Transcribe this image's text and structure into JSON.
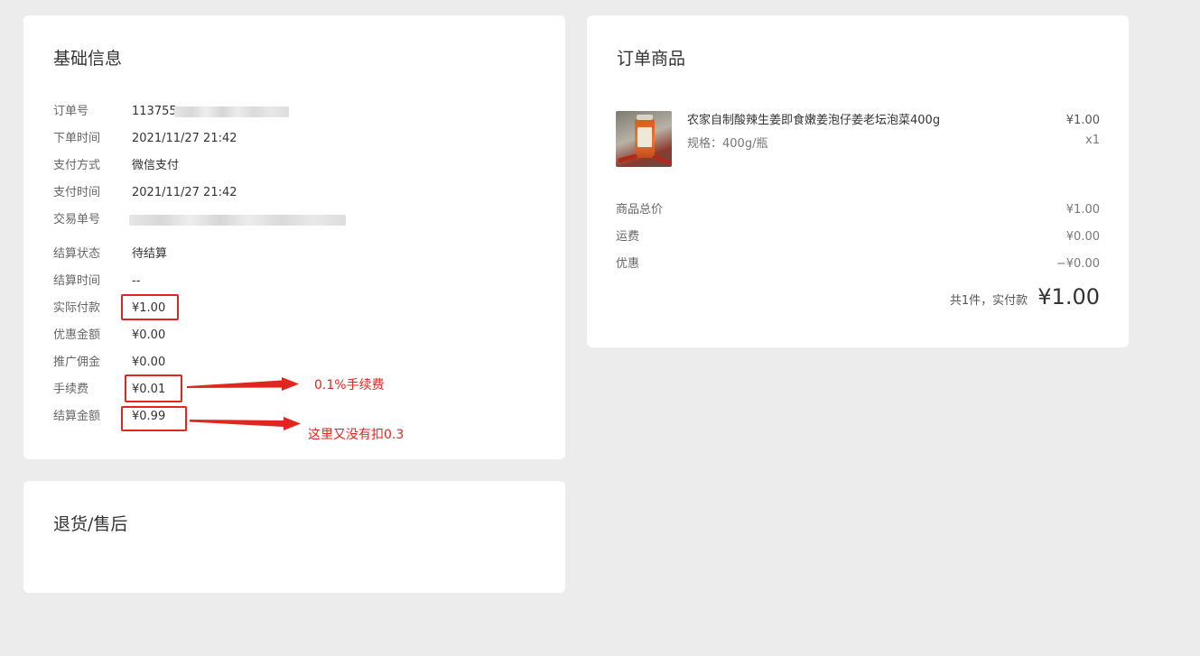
{
  "basic_info": {
    "title": "基础信息",
    "rows": [
      {
        "label": "订单号",
        "value": "113755"
      },
      {
        "label": "下单时间",
        "value": "2021/11/27 21:42"
      },
      {
        "label": "支付方式",
        "value": "微信支付"
      },
      {
        "label": "支付时间",
        "value": "2021/11/27 21:42"
      },
      {
        "label": "交易单号",
        "value": ""
      },
      {
        "label": "结算状态",
        "value": "待结算"
      },
      {
        "label": "结算时间",
        "value": "--"
      },
      {
        "label": "实际付款",
        "value": "¥1.00"
      },
      {
        "label": "优惠金额",
        "value": "¥0.00"
      },
      {
        "label": "推广佣金",
        "value": "¥0.00"
      },
      {
        "label": "手续费",
        "value": "¥0.01"
      },
      {
        "label": "结算金额",
        "value": "¥0.99"
      }
    ]
  },
  "annotations": {
    "fee_note": "0.1%手续费",
    "settle_note": "这里又没有扣0.3"
  },
  "refund": {
    "title": "退货/售后"
  },
  "order_goods": {
    "title": "订单商品",
    "product": {
      "name": "农家自制酸辣生姜即食嫩姜泡仔姜老坛泡菜400g",
      "spec": "规格：400g/瓶",
      "price": "¥1.00",
      "qty": "x1"
    },
    "summary": [
      {
        "label": "商品总价",
        "value": "¥1.00"
      },
      {
        "label": "运费",
        "value": "¥0.00"
      },
      {
        "label": "优惠",
        "value": "−¥0.00"
      }
    ],
    "total_prefix": "共1件，实付款",
    "total_amount": "¥1.00"
  },
  "colors": {
    "background": "#ececec",
    "card": "#ffffff",
    "annotation_red": "#e0271f"
  }
}
